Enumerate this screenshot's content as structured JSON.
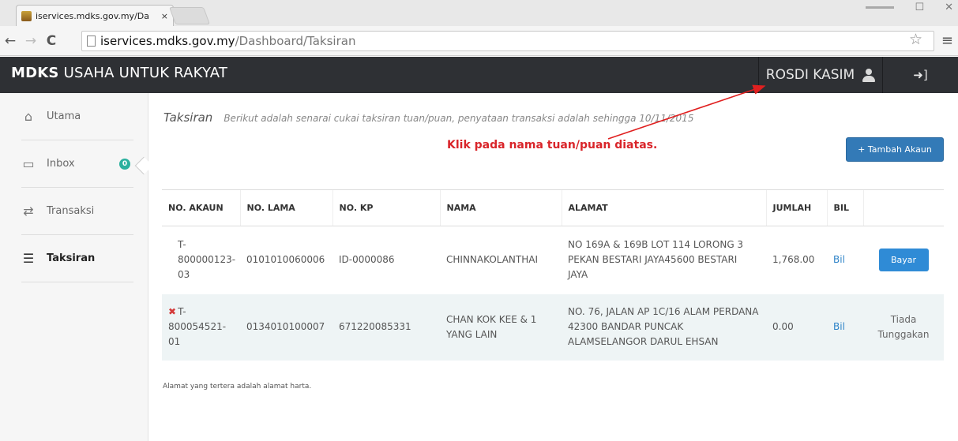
{
  "browser": {
    "tab_title": "iservices.mdks.gov.my/Da",
    "tab_close": "×",
    "url_host": "iservices.mdks.gov.my",
    "url_path": "/Dashboard/Taksiran"
  },
  "app": {
    "brand_bold": "MDKS",
    "brand_text": "USAHA UNTUK RAKYAT",
    "user_name": "ROSDI KASIM"
  },
  "sidebar": {
    "items": [
      {
        "label": "Utama",
        "icon": "home-icon"
      },
      {
        "label": "Inbox",
        "icon": "inbox-icon",
        "badge": "0"
      },
      {
        "label": "Transaksi",
        "icon": "exchange-icon"
      },
      {
        "label": "Taksiran",
        "icon": "list-ol-icon"
      }
    ]
  },
  "main": {
    "title": "Taksiran",
    "subtitle": "Berikut adalah senarai cukai taksiran tuan/puan, penyataan transaksi adalah sehingga 10/11/2015",
    "annotation": "Klik pada nama tuan/puan diatas.",
    "add_button": "+ Tambah Akaun",
    "columns": [
      "NO. AKAUN",
      "NO. LAMA",
      "NO. KP",
      "NAMA",
      "ALAMAT",
      "JUMLAH",
      "BIL",
      ""
    ],
    "rows": [
      {
        "x_mark": "",
        "akaun": "T-800000123-03",
        "lama": "0101010060006",
        "kp": "ID-0000086",
        "nama": "CHINNAKOLANTHAI",
        "alamat": "NO 169A & 169B LOT 114 LORONG 3 PEKAN BESTARI JAYA45600 BESTARI JAYA",
        "jumlah": "1,768.00",
        "bil": "Bil",
        "action": "Bayar"
      },
      {
        "x_mark": "✖",
        "akaun": "T-800054521-01",
        "lama": "0134010100007",
        "kp": "671220085331",
        "nama": "CHAN KOK KEE & 1 YANG LAIN",
        "alamat": "NO. 76, JALAN AP 1C/16 ALAM PERDANA 42300 BANDAR PUNCAK ALAMSELANGOR DARUL EHSAN",
        "jumlah": "0.00",
        "bil": "Bil",
        "action": "Tiada Tunggakan"
      }
    ],
    "footnote": "Alamat yang tertera adalah alamat harta."
  },
  "colors": {
    "header_bg": "#2e3034",
    "annotation_red": "#d9252a",
    "primary_blue": "#337ab7",
    "badge_teal": "#2bb09e"
  }
}
